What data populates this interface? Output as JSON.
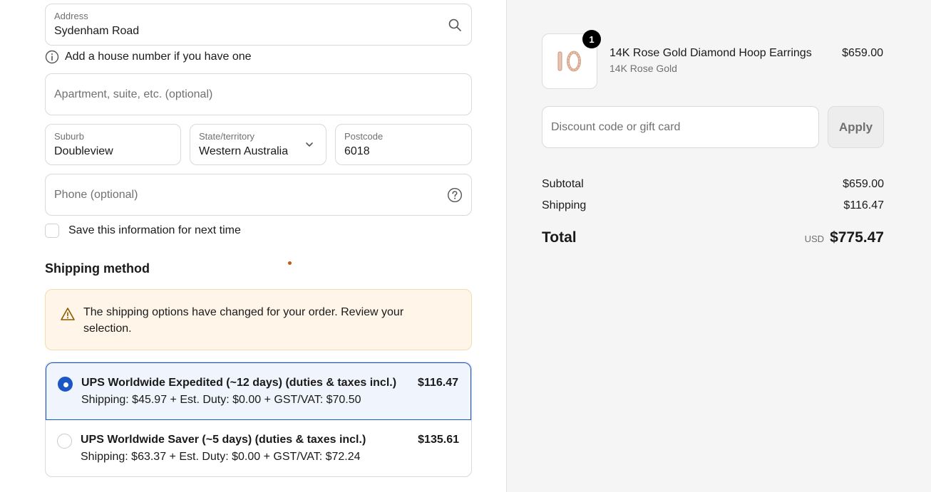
{
  "address": {
    "label": "Address",
    "value": "Sydenham Road"
  },
  "hint": "Add a house number if you have one",
  "apartment": {
    "placeholder": "Apartment, suite, etc. (optional)"
  },
  "suburb": {
    "label": "Suburb",
    "value": "Doubleview"
  },
  "state": {
    "label": "State/territory",
    "value": "Western Australia"
  },
  "postcode": {
    "label": "Postcode",
    "value": "6018"
  },
  "phone": {
    "placeholder": "Phone (optional)"
  },
  "save_info": "Save this information for next time",
  "shipping": {
    "title": "Shipping method",
    "notice": "The shipping options have changed for your order. Review your selection.",
    "options": [
      {
        "name": "UPS Worldwide Expedited (~12 days) (duties & taxes incl.)",
        "breakdown": "Shipping: $45.97 + Est. Duty: $0.00 + GST/VAT: $70.50",
        "price": "$116.47",
        "selected": true
      },
      {
        "name": "UPS Worldwide Saver (~5 days) (duties & taxes incl.)",
        "breakdown": "Shipping: $63.37 + Est. Duty: $0.00 + GST/VAT: $72.24",
        "price": "$135.61",
        "selected": false
      }
    ]
  },
  "summary": {
    "product": {
      "name": "14K Rose Gold Diamond Hoop Earrings",
      "variant": "14K Rose Gold",
      "price": "$659.00",
      "quantity": "1"
    },
    "discount_placeholder": "Discount code or gift card",
    "apply_label": "Apply",
    "subtotal_label": "Subtotal",
    "subtotal_value": "$659.00",
    "shipping_label": "Shipping",
    "shipping_value": "$116.47",
    "total_label": "Total",
    "currency": "USD",
    "total_value": "$775.47"
  },
  "colors": {
    "accent": "#1a56c4",
    "notice_bg": "#fff5e8",
    "sidebar_bg": "#f5f5f5"
  },
  "icons": {
    "address": "search-icon",
    "hint": "info-icon",
    "state": "chevron-down-icon",
    "phone": "help-icon",
    "notice": "warning-icon"
  }
}
